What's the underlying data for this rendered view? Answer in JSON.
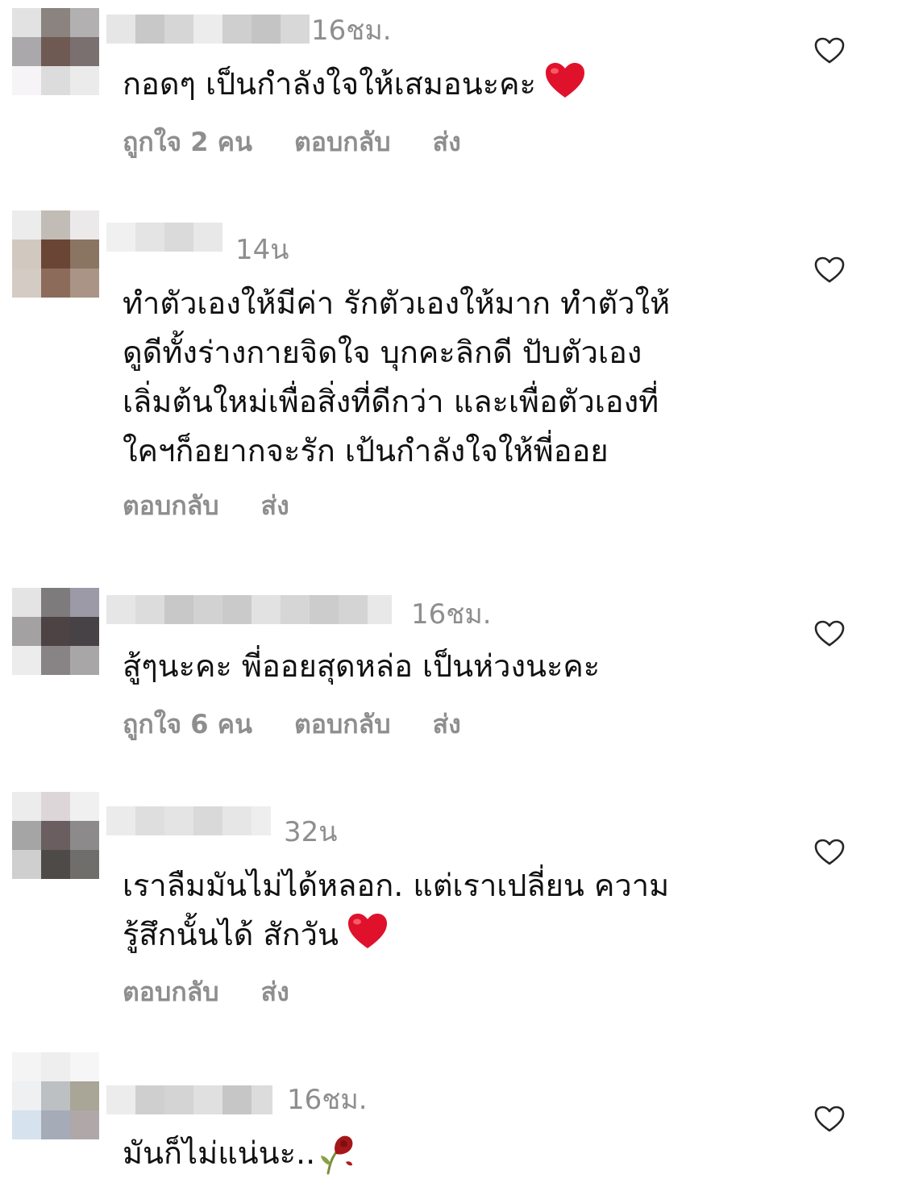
{
  "comments": [
    {
      "time": "16ชม.",
      "text": [
        "กอดๆ เป็นกำลังใจให้เสมอนะคะ"
      ],
      "likes_label": "ถูกใจ 2 คน",
      "reply_label": "ตอบกลับ",
      "send_label": "ส่ง",
      "trailing_emoji": "heart"
    },
    {
      "time": "14น",
      "text": [
        "ทำตัวเองให้มีค่า รักตัวเองให้มาก ทำตัวให้",
        "ดูดีทั้งร่างกายจิดใจ บุกคะลิกดี ปับตัวเอง",
        "เลิ่มต้นใหม่เพื่อสิ่งที่ดีกว่า และเพื่อตัวเองที่",
        "ใคฯก็อยากจะรัก เป้นกำลังใจให้พี่ออย"
      ],
      "reply_label": "ตอบกลับ",
      "send_label": "ส่ง"
    },
    {
      "time": "16ชม.",
      "text": [
        "สู้ๆนะคะ พี่ออยสุดหล่อ เป็นห่วงนะคะ"
      ],
      "likes_label": "ถูกใจ 6 คน",
      "reply_label": "ตอบกลับ",
      "send_label": "ส่ง"
    },
    {
      "time": "32น",
      "text": [
        "เราลืมมันไม่ได้หลอก. แต่เราเปลี่ยน ความ",
        "รู้สึกนั้นได้  สักวัน"
      ],
      "reply_label": "ตอบกลับ",
      "send_label": "ส่ง",
      "trailing_emoji": "heart"
    },
    {
      "time": "16ชม.",
      "text": [
        "มันก็ไม่แน่นะ.."
      ],
      "trailing_emoji": "wilted-rose"
    }
  ],
  "colors": {
    "text": "#111111",
    "meta": "#8e8e8e",
    "heart_emoji": "#e0112b",
    "like_icon_stroke": "#262626"
  },
  "icons": {
    "like": "heart-outline-icon",
    "emoji_heart": "red-heart-emoji",
    "emoji_rose": "wilted-flower-emoji"
  }
}
